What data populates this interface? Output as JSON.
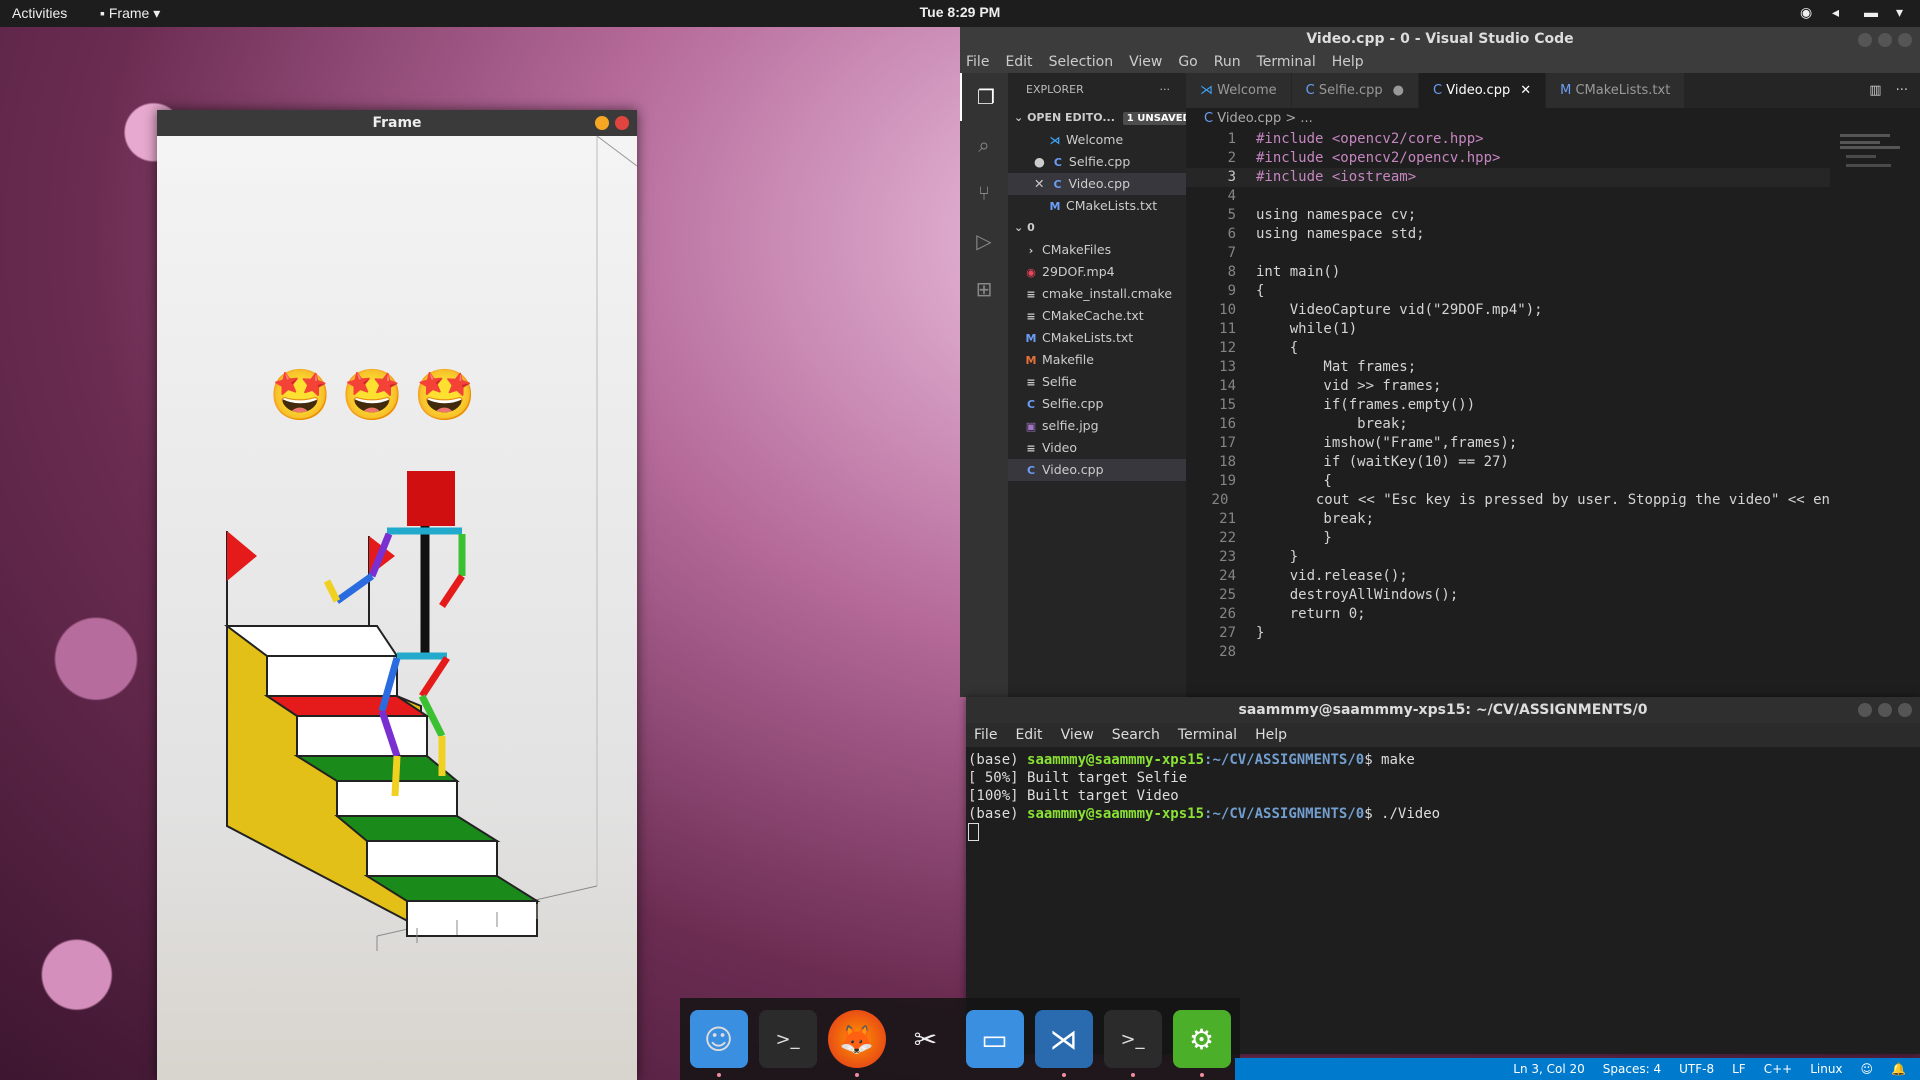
{
  "topbar": {
    "activities": "Activities",
    "app_menu": "Frame",
    "clock": "Tue  8:29 PM"
  },
  "frame_window": {
    "title": "Frame",
    "emojis": [
      "🤩",
      "🤩",
      "🤩"
    ]
  },
  "vscode": {
    "title": "Video.cpp - 0 - Visual Studio Code",
    "menu": [
      "File",
      "Edit",
      "Selection",
      "View",
      "Go",
      "Run",
      "Terminal",
      "Help"
    ],
    "explorer": {
      "header": "EXPLORER",
      "open_editors_label": "OPEN EDITO...",
      "unsaved_badge": "1 UNSAVED",
      "open_editors": [
        "Welcome",
        "Selfie.cpp",
        "Video.cpp",
        "CMakeLists.txt"
      ],
      "folder_name": "0",
      "files": [
        "CMakeFiles",
        "29DOF.mp4",
        "cmake_install.cmake",
        "CMakeCache.txt",
        "CMakeLists.txt",
        "Makefile",
        "Selfie",
        "Selfie.cpp",
        "selfie.jpg",
        "Video",
        "Video.cpp"
      ]
    },
    "tabs": [
      "Welcome",
      "Selfie.cpp",
      "Video.cpp",
      "CMakeLists.txt"
    ],
    "breadcrumb": "Video.cpp > ...",
    "code_lines": [
      "#include <opencv2/core.hpp>",
      "#include <opencv2/opencv.hpp>",
      "#include <iostream>",
      "",
      "using namespace cv;",
      "using namespace std;",
      "",
      "int main()",
      "{",
      "    VideoCapture vid(\"29DOF.mp4\");",
      "    while(1)",
      "    {",
      "        Mat frames;",
      "        vid >> frames;",
      "        if(frames.empty())",
      "            break;",
      "        imshow(\"Frame\",frames);",
      "        if (waitKey(10) == 27)",
      "        {",
      "        cout << \"Esc key is pressed by user. Stoppig the video\" << en",
      "        break;",
      "        }",
      "    }",
      "    vid.release();",
      "    destroyAllWindows();",
      "    return 0;",
      "}",
      ""
    ],
    "line_numbers": [
      "1",
      "2",
      "3",
      "4",
      "5",
      "6",
      "7",
      "8",
      "9",
      "10",
      "11",
      "12",
      "13",
      "14",
      "15",
      "16",
      "17",
      "18",
      "19",
      "20",
      "21",
      "22",
      "23",
      "24",
      "25",
      "26",
      "27",
      "28"
    ]
  },
  "terminal": {
    "title": "saammmy@saammmy-xps15: ~/CV/ASSIGNMENTS/0",
    "menu": [
      "File",
      "Edit",
      "View",
      "Search",
      "Terminal",
      "Help"
    ],
    "prompt_prefix": "(base) ",
    "user_host": "saammmy@saammmy-xps15",
    "path": ":~/CV/ASSIGNMENTS/0",
    "cmd1": "$ make",
    "out1": "[ 50%] Built target Selfie",
    "out2": "[100%] Built target Video",
    "cmd2": "$ ./Video"
  },
  "statusbar": {
    "position": "Ln 3, Col 20",
    "spaces": "Spaces: 4",
    "encoding": "UTF-8",
    "eol": "LF",
    "language": "C++",
    "os": "Linux"
  },
  "dock": [
    "files-icon",
    "terminal-icon",
    "firefox-icon",
    "scissors-icon",
    "window-icon",
    "vscode-icon",
    "terminal-icon",
    "settings-icon"
  ]
}
